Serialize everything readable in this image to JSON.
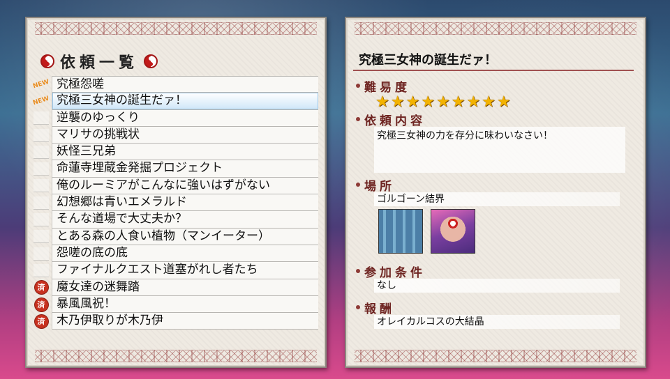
{
  "left_panel": {
    "header_title": "依頼一覧",
    "items": [
      {
        "label": "究極怨嗟",
        "badge": "NEW"
      },
      {
        "label": "究極三女神の誕生だァ！",
        "badge": "NEW",
        "selected": true
      },
      {
        "label": "逆襲のゆっくり",
        "badge": ""
      },
      {
        "label": "マリサの挑戦状",
        "badge": ""
      },
      {
        "label": "妖怪三兄弟",
        "badge": ""
      },
      {
        "label": "命蓮寺埋蔵金発掘プロジェクト",
        "badge": ""
      },
      {
        "label": "俺のルーミアがこんなに強いはずがない",
        "badge": ""
      },
      {
        "label": "幻想郷は青いエメラルド",
        "badge": ""
      },
      {
        "label": "そんな道場で大丈夫か？",
        "badge": ""
      },
      {
        "label": "とある森の人食い植物（マンイーター）",
        "badge": ""
      },
      {
        "label": "怨嗟の底の底",
        "badge": ""
      },
      {
        "label": "ファイナルクエスト道塞がれし者たち",
        "badge": ""
      },
      {
        "label": "魔女達の迷舞踏",
        "badge": "済"
      },
      {
        "label": "暴風風祝！",
        "badge": "済"
      },
      {
        "label": "木乃伊取りが木乃伊",
        "badge": "済"
      }
    ]
  },
  "right_panel": {
    "title": "究極三女神の誕生だァ！",
    "difficulty_label": "難易度",
    "difficulty_stars": 9,
    "content_label": "依頼内容",
    "content_text": "究極三女神の力を存分に味わいなさい！",
    "location_label": "場所",
    "location_text": "ゴルゴーン結界",
    "condition_label": "参加条件",
    "condition_text": "なし",
    "reward_label": "報酬",
    "reward_text": "オレイカルコスの大結晶"
  },
  "colors": {
    "accent_red": "#6e2421",
    "star": "#f3b300",
    "selected_row": "#cfe6f8"
  }
}
